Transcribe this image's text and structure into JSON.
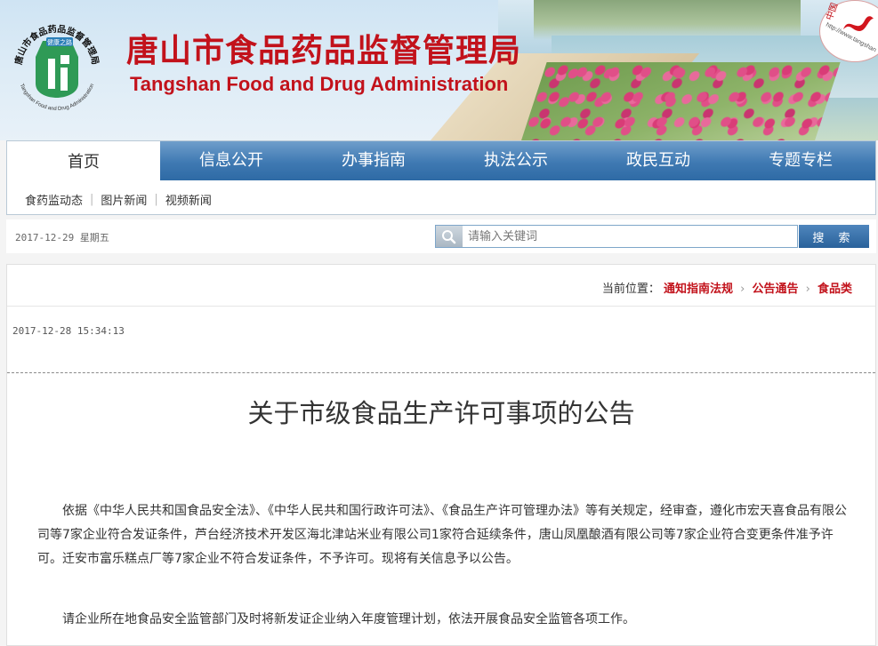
{
  "header": {
    "title_cn": "唐山市食品药品监督管理局",
    "title_en": "Tangshan Food and Drug Administration",
    "logo": {
      "top_text": "唐山市食品药品监督管理局",
      "badge_text": "健康之路",
      "bottom_text": "Tangshan Food and Drug Administration"
    },
    "stamp": {
      "cn_text": "中国",
      "url_text": "http://www.tangshan"
    }
  },
  "nav": {
    "items": [
      {
        "label": "首页"
      },
      {
        "label": "信息公开"
      },
      {
        "label": "办事指南"
      },
      {
        "label": "执法公示"
      },
      {
        "label": "政民互动"
      },
      {
        "label": "专题专栏"
      }
    ],
    "sub_items": [
      {
        "label": "食药监动态"
      },
      {
        "label": "图片新闻"
      },
      {
        "label": "视频新闻"
      }
    ]
  },
  "datebar": {
    "date": "2017-12-29 星期五",
    "search_placeholder": "请输入关键词",
    "search_button": "搜 索"
  },
  "breadcrumb": {
    "prefix": "当前位置：",
    "items": [
      {
        "label": "通知指南法规"
      },
      {
        "label": "公告通告"
      },
      {
        "label": "食品类"
      }
    ]
  },
  "article": {
    "timestamp": "2017-12-28 15:34:13",
    "title": "关于市级食品生产许可事项的公告",
    "paragraphs": [
      "依据《中华人民共和国食品安全法》、《中华人民共和国行政许可法》、《食品生产许可管理办法》等有关规定，经审查，遵化市宏天喜食品有限公司等7家企业符合发证条件，芦台经济技术开发区海北津站米业有限公司1家符合延续条件，唐山凤凰酿酒有限公司等7家企业符合变更条件准予许可。迁安市富乐糕点厂等7家企业不符合发证条件，不予许可。现将有关信息予以公告。",
      "请企业所在地食品安全监管部门及时将新发证企业纳入年度管理计划，依法开展食品安全监管各项工作。"
    ]
  },
  "colors": {
    "brand_red": "#c2121b",
    "nav_blue": "#3f79b2"
  }
}
